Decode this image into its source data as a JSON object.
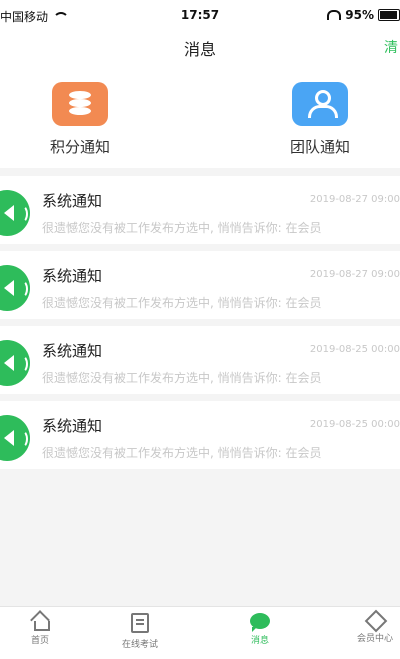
{
  "status_bar": {
    "carrier": "中国移动",
    "time": "17:57",
    "battery": "95%"
  },
  "nav": {
    "title": "消息",
    "action": "清"
  },
  "categories": [
    {
      "label": "积分通知",
      "icon": "database-icon",
      "color": "#f28a52"
    },
    {
      "label": "团队通知",
      "icon": "team-icon",
      "color": "#4aa5f4"
    }
  ],
  "messages": [
    {
      "title": "系统通知",
      "time": "2019-08-27 09:00",
      "preview": "很遗憾您没有被工作发布方选中, 悄悄告诉你: 在会员"
    },
    {
      "title": "系统通知",
      "time": "2019-08-27 09:00",
      "preview": "很遗憾您没有被工作发布方选中, 悄悄告诉你: 在会员"
    },
    {
      "title": "系统通知",
      "time": "2019-08-25 00:00",
      "preview": "很遗憾您没有被工作发布方选中, 悄悄告诉你: 在会员"
    },
    {
      "title": "系统通知",
      "time": "2019-08-25 00:00",
      "preview": "很遗憾您没有被工作发布方选中, 悄悄告诉你: 在会员"
    }
  ],
  "tabs": [
    {
      "label": "首页",
      "icon": "home-icon",
      "active": false
    },
    {
      "label": "在线考试",
      "icon": "exam-icon",
      "active": false
    },
    {
      "label": "消息",
      "icon": "message-icon",
      "active": true
    },
    {
      "label": "会员中心",
      "icon": "member-icon",
      "active": false
    }
  ],
  "colors": {
    "accent": "#2ebc5b",
    "muted_text": "#c8c8c8"
  }
}
